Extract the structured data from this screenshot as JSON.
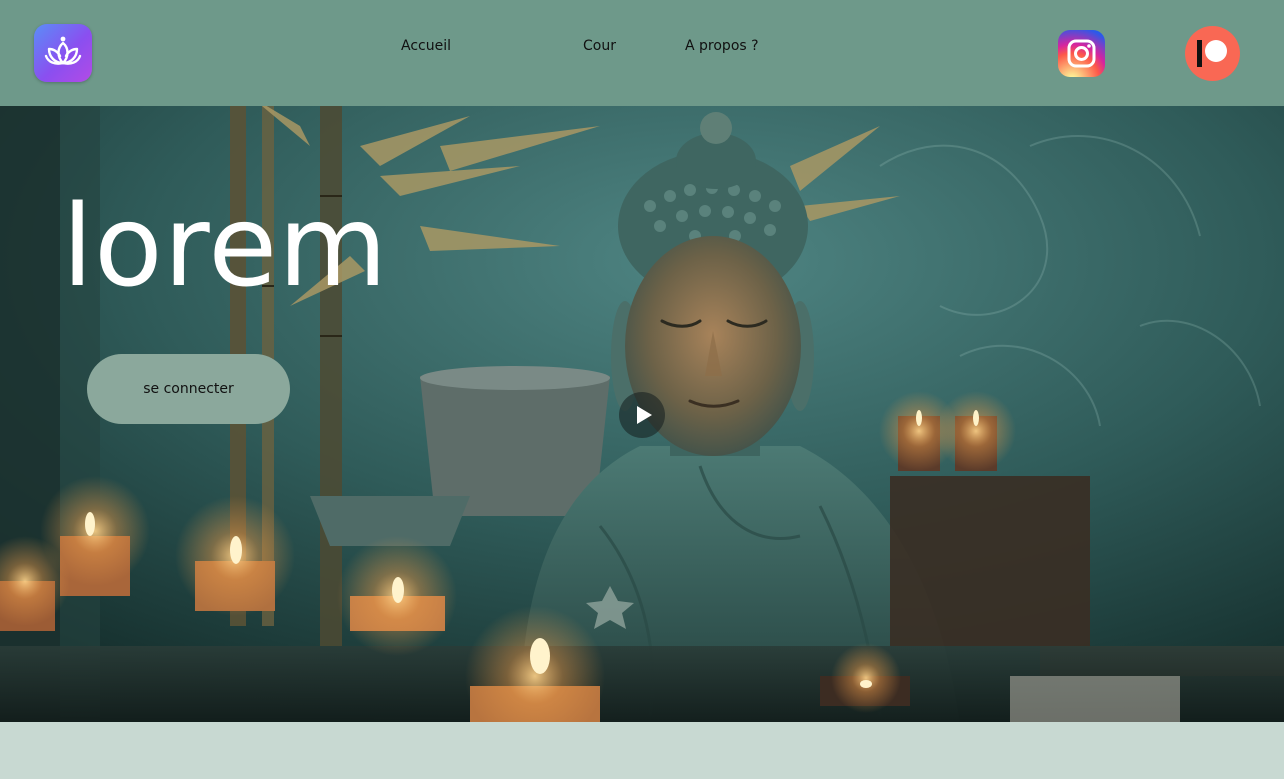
{
  "header": {
    "logo_icon": "lotus-icon",
    "nav": [
      {
        "label": "Accueil"
      },
      {
        "label": "Cour"
      },
      {
        "label": "A propos ?"
      }
    ],
    "social": {
      "instagram_icon": "instagram-icon",
      "patreon_icon": "patreon-icon"
    }
  },
  "hero": {
    "title": "lorem",
    "connect_label": "se connecter",
    "play_icon": "play-icon",
    "background_image": "buddha-statue-with-candles"
  },
  "colors": {
    "header_bg": "#6e998a",
    "button_bg": "#8ba89c",
    "page_bg": "#c8d9d2",
    "hero_title": "#ffffff",
    "patreon": "#f96854"
  }
}
